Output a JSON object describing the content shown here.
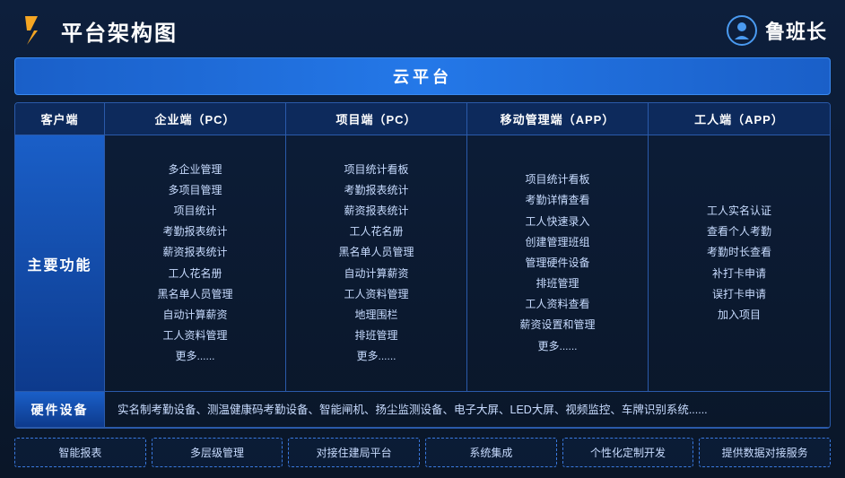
{
  "header": {
    "title": "平台架构图",
    "brand": "鲁班长"
  },
  "cloud_bar": "云平台",
  "col_headers": {
    "client": "客户端",
    "enterprise": "企业端（PC）",
    "project": "项目端（PC）",
    "mobile": "移动管理端（APP）",
    "worker": "工人端（APP）"
  },
  "main_function_label": "主要功能",
  "enterprise_items": [
    "多企业管理",
    "多项目管理",
    "项目统计",
    "考勤报表统计",
    "薪资报表统计",
    "工人花名册",
    "黑名单人员管理",
    "自动计算薪资",
    "工人资料管理",
    "更多......"
  ],
  "project_items": [
    "项目统计看板",
    "考勤报表统计",
    "薪资报表统计",
    "工人花名册",
    "黑名单人员管理",
    "自动计算薪资",
    "工人资料管理",
    "地理围栏",
    "排班管理",
    "更多......"
  ],
  "mobile_items": [
    "项目统计看板",
    "考勤详情查看",
    "工人快速录入",
    "创建管理班组",
    "管理硬件设备",
    "排班管理",
    "工人资料查看",
    "薪资设置和管理",
    "更多......"
  ],
  "worker_items": [
    "工人实名认证",
    "查看个人考勤",
    "考勤时长查看",
    "补打卡申请",
    "误打卡申请",
    "加入项目"
  ],
  "hardware_label": "硬件设备",
  "hardware_content": "实名制考勤设备、测温健康码考勤设备、智能闸机、扬尘监测设备、电子大屏、LED大屏、视频监控、车牌识别系统......",
  "features": [
    "智能报表",
    "多层级管理",
    "对接住建局平台",
    "系统集成",
    "个性化定制开发",
    "提供数据对接服务"
  ]
}
